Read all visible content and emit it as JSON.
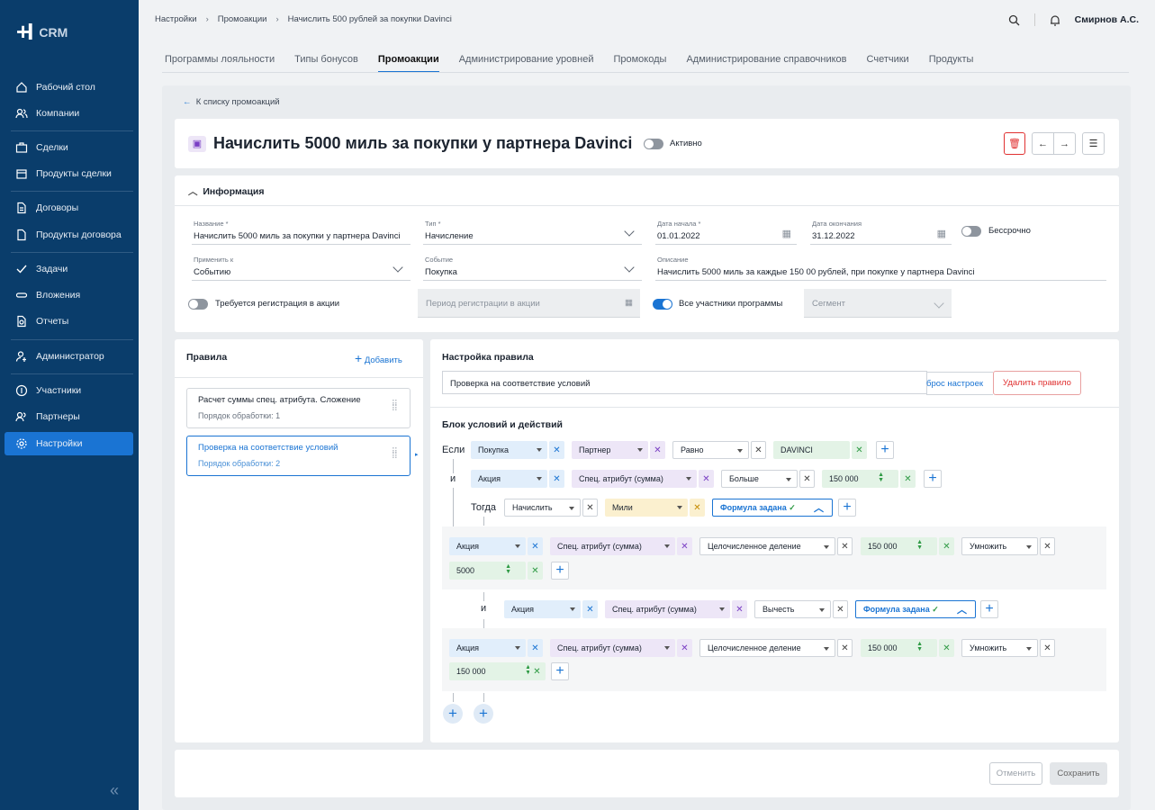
{
  "app": {
    "logo": "+I",
    "name": "CRM"
  },
  "sidebar": [
    "Рабочий стол",
    "Компании",
    "Сделки",
    "Продукты сделки",
    "Договоры",
    "Продукты договора",
    "Задачи",
    "Вложения",
    "Отчеты",
    "Администратор",
    "Участники",
    "Партнеры",
    "Настройки"
  ],
  "breadcrumb": [
    "Настройки",
    "Промоакции",
    "Начислить 500 рублей за покупки Davinci"
  ],
  "user": "Смирнов А.С.",
  "tabs": [
    "Программы лояльности",
    "Типы бонусов",
    "Промоакции",
    "Администрирование уровней",
    "Промокоды",
    "Администрирование справочников",
    "Счетчики",
    "Продукты"
  ],
  "back": "К списку промоакций",
  "promo": {
    "title": "Начислить 5000 миль за покупки у партнера Davinci",
    "status": "Активно"
  },
  "info": {
    "section": "Информация",
    "name_l": "Название *",
    "name": "Начислить 5000 миль за покупки у партнера Davinci",
    "type_l": "Тип *",
    "type": "Начисление",
    "start_l": "Дата начала *",
    "start": "01.01.2022",
    "end_l": "Дата окончания",
    "end": "31.12.2022",
    "forever": "Бессрочно",
    "apply_l": "Применить к",
    "apply": "Событию",
    "event_l": "Событие",
    "event": "Покупка",
    "desc_l": "Описание",
    "desc": "Начислить 5000 миль за каждые 150 00 рублей, при покупке у партнера Davinci",
    "reg": "Требуется регистрация в акции",
    "period": "Период регистрации в акции",
    "all": "Все участники программы",
    "segment": "Сегмент"
  },
  "rules": {
    "title": "Правила",
    "add": "Добавить",
    "items": [
      {
        "name": "Расчет суммы спец. атрибута. Сложение",
        "order": "Порядок обработки: 1"
      },
      {
        "name": "Проверка на соответствие условий",
        "order": "Порядок обработки: 2"
      }
    ]
  },
  "setting": {
    "title": "Настройка правила",
    "name": "Проверка на соответствие условий",
    "reset": "брос настроек",
    "delete": "Удалить правило",
    "block": "Блок условий и действий",
    "if": "Если",
    "and": "и",
    "then": "Тогда",
    "purchase": "Покупка",
    "partner": "Партнер",
    "equals": "Равно",
    "davinci": "DAVINCI",
    "promo": "Акция",
    "attr": "Спец. атрибут (сумма)",
    "more": "Больше",
    "v150": "150 000",
    "accrue": "Начислить",
    "miles": "Мили",
    "formula": "Формула задана",
    "intdiv": "Целочисленное деление",
    "mult": "Умножить",
    "v5000": "5000",
    "minus": "Вычесть"
  },
  "footer": {
    "cancel": "Отменить",
    "save": "Сохранить"
  }
}
